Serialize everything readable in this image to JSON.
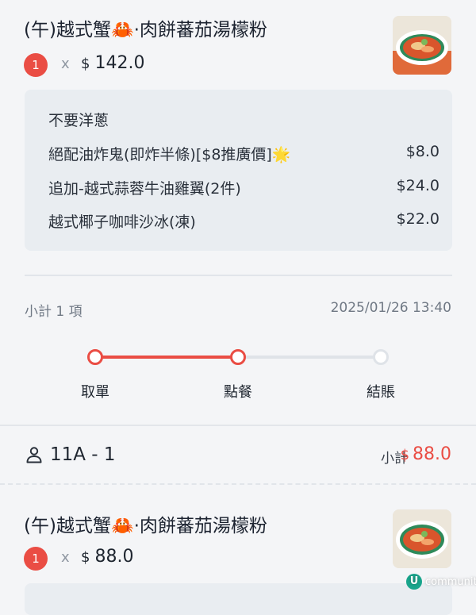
{
  "items": [
    {
      "title": "(午)越式蟹🦀·肉餅蕃茄湯檬粉",
      "quantity": "1",
      "times": "x",
      "currency": "$",
      "price": "142.0",
      "options": [
        {
          "name": "不要洋蔥",
          "price": ""
        },
        {
          "name": "絕配油炸鬼(即炸半條)[$8推廣價]🌟",
          "price": "$8.0"
        },
        {
          "name": "追加-越式蒜蓉牛油雞翼(2件)",
          "price": "$24.0"
        },
        {
          "name": "越式椰子咖啡沙冰(凍)",
          "price": "$22.0"
        }
      ]
    },
    {
      "title": "(午)越式蟹🦀·肉餅蕃茄湯檬粉",
      "quantity": "1",
      "times": "x",
      "currency": "$",
      "price": "88.0"
    }
  ],
  "summary": {
    "count_label": "小計 1 項",
    "timestamp": "2025/01/26 13:40"
  },
  "progress": {
    "steps": [
      "取單",
      "點餐",
      "結賬"
    ],
    "current_step": 2
  },
  "table": {
    "label": "11A - 1",
    "subtotal_label": "小計",
    "currency": "$",
    "subtotal_value": "88.0"
  },
  "watermark": {
    "mark": "U",
    "text": "community"
  },
  "colors": {
    "accent": "#ea4d44",
    "background": "#f4f5f7",
    "option_box": "#e9edf1",
    "inactive": "#dfe3e8"
  }
}
